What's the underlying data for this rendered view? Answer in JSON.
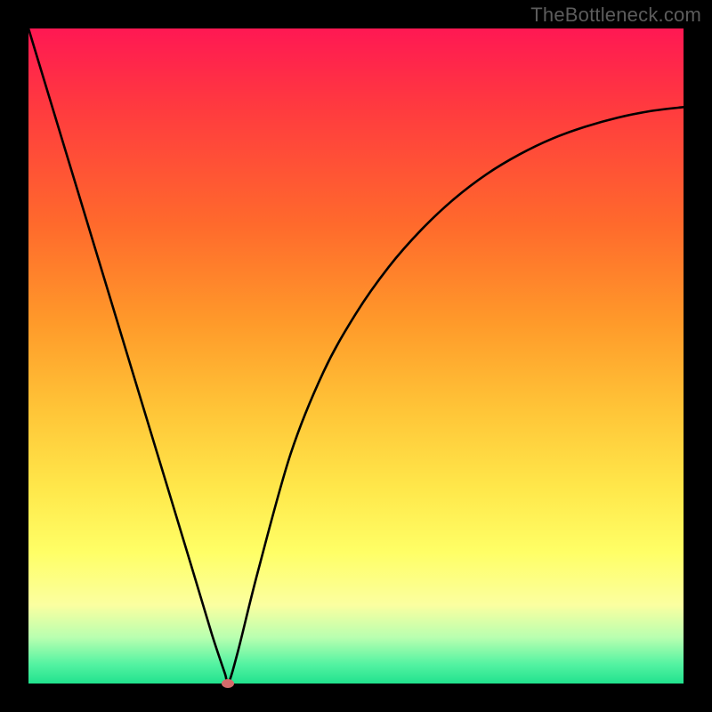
{
  "watermark": "TheBottleneck.com",
  "colors": {
    "page_bg": "#000000",
    "curve": "#000000",
    "marker": "#d46a6a",
    "gradient_top": "#ff1853",
    "gradient_bottom": "#21e28e"
  },
  "chart_data": {
    "type": "line",
    "title": "",
    "xlabel": "",
    "ylabel": "",
    "xlim": [
      0,
      1
    ],
    "ylim": [
      0,
      1
    ],
    "grid": false,
    "legend": false,
    "annotations": [
      {
        "text": "TheBottleneck.com",
        "position": "top-right"
      }
    ],
    "marker": {
      "x": 0.305,
      "y": 0.0,
      "color": "#d46a6a"
    },
    "series": [
      {
        "name": "bottleneck-curve",
        "x": [
          0.0,
          0.05,
          0.1,
          0.15,
          0.2,
          0.25,
          0.28,
          0.3,
          0.305,
          0.32,
          0.35,
          0.4,
          0.45,
          0.5,
          0.55,
          0.6,
          0.65,
          0.7,
          0.75,
          0.8,
          0.85,
          0.9,
          0.95,
          1.0
        ],
        "y": [
          1.0,
          0.835,
          0.67,
          0.505,
          0.34,
          0.175,
          0.075,
          0.015,
          0.0,
          0.05,
          0.17,
          0.35,
          0.475,
          0.565,
          0.636,
          0.693,
          0.74,
          0.778,
          0.808,
          0.832,
          0.85,
          0.864,
          0.874,
          0.88
        ]
      }
    ]
  }
}
